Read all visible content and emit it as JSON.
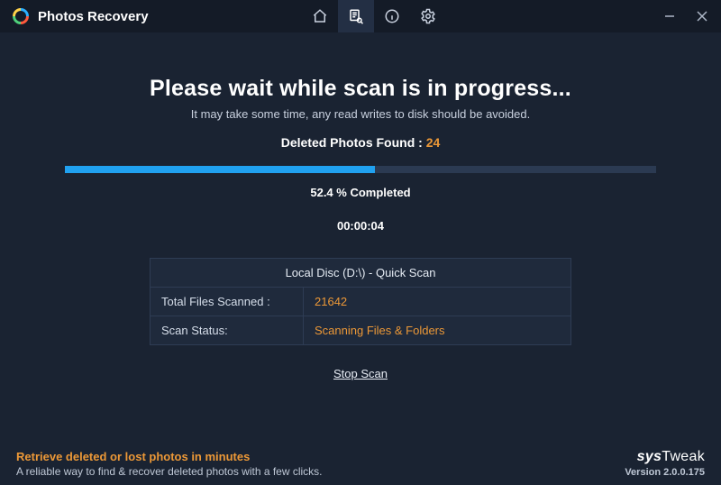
{
  "title": "Photos Recovery",
  "heading": "Please wait while scan is in progress...",
  "sub": "It may take some time, any read writes to disk should be avoided.",
  "found": {
    "label": "Deleted Photos Found : ",
    "count": "24"
  },
  "progress": {
    "percent": 52.4,
    "label": "52.4 % Completed",
    "elapsed": "00:00:04"
  },
  "panel": {
    "header": "Local Disc (D:\\) - Quick Scan",
    "rows": [
      {
        "label": "Total Files Scanned :",
        "value": "21642"
      },
      {
        "label": "Scan Status:",
        "value": "Scanning Files & Folders"
      }
    ]
  },
  "stop": "Stop Scan",
  "footer": {
    "tag1": "Retrieve deleted or lost photos in minutes",
    "tag2": "A reliable way to find & recover deleted photos with a few clicks.",
    "brand1": "sys",
    "brand2": "Tweak",
    "version": "Version 2.0.0.175"
  }
}
